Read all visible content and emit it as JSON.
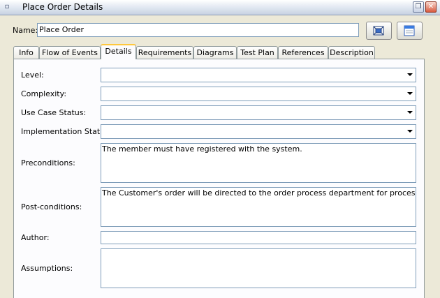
{
  "window": {
    "title": "Place Order Details",
    "restore_glyph": "❐",
    "close_glyph": "✕"
  },
  "name": {
    "label": "Name:",
    "value": "Place Order"
  },
  "toolbar": {
    "icons": [
      "fit-view-icon",
      "window-icon"
    ]
  },
  "tabs": [
    {
      "label": "Info"
    },
    {
      "label": "Flow of Events"
    },
    {
      "label": "Details",
      "active": true
    },
    {
      "label": "Requirements"
    },
    {
      "label": "Diagrams"
    },
    {
      "label": "Test Plan"
    },
    {
      "label": "References"
    },
    {
      "label": "Description"
    }
  ],
  "details": {
    "level": {
      "label": "Level:",
      "value": ""
    },
    "complexity": {
      "label": "Complexity:",
      "value": ""
    },
    "use_case_status": {
      "label": "Use Case Status:",
      "value": ""
    },
    "implementation_status": {
      "label": "Implementation Status:",
      "value": ""
    },
    "preconditions": {
      "label": "Preconditions:",
      "value": "The member must have registered with the system."
    },
    "postconditions": {
      "label": "Post-conditions:",
      "value": "The Customer's order will be directed to the order process department for processing."
    },
    "author": {
      "label": "Author:",
      "value": ""
    },
    "assumptions": {
      "label": "Assumptions:",
      "value": ""
    }
  },
  "colors": {
    "window_bg": "#ECE9D8",
    "panel_bg": "#FCFCFE",
    "field_border": "#7F9DB9",
    "active_tab_accent": "#FFC83C"
  }
}
